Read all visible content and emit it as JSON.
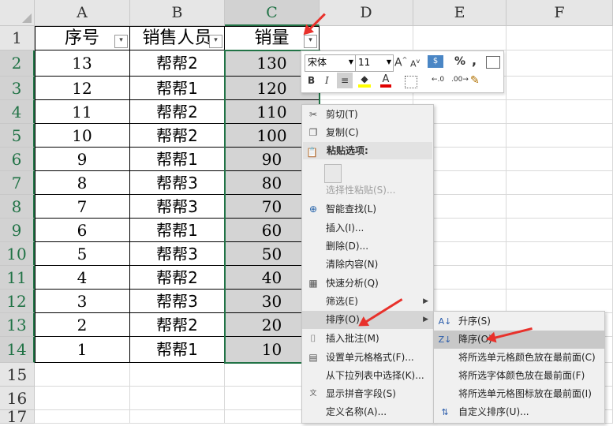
{
  "columns": [
    "A",
    "B",
    "C",
    "D",
    "E",
    "F"
  ],
  "rows": [
    "1",
    "2",
    "3",
    "4",
    "5",
    "6",
    "7",
    "8",
    "9",
    "10",
    "11",
    "12",
    "13",
    "14",
    "15",
    "16",
    "17"
  ],
  "headers": {
    "a": "序号",
    "b": "销售人员",
    "c": "销量"
  },
  "table": [
    {
      "a": "13",
      "b": "帮帮2",
      "c": "130"
    },
    {
      "a": "12",
      "b": "帮帮1",
      "c": "120"
    },
    {
      "a": "11",
      "b": "帮帮2",
      "c": "110"
    },
    {
      "a": "10",
      "b": "帮帮2",
      "c": "100"
    },
    {
      "a": "9",
      "b": "帮帮1",
      "c": "90"
    },
    {
      "a": "8",
      "b": "帮帮3",
      "c": "80"
    },
    {
      "a": "7",
      "b": "帮帮3",
      "c": "70"
    },
    {
      "a": "6",
      "b": "帮帮1",
      "c": "60"
    },
    {
      "a": "5",
      "b": "帮帮3",
      "c": "50"
    },
    {
      "a": "4",
      "b": "帮帮2",
      "c": "40"
    },
    {
      "a": "3",
      "b": "帮帮3",
      "c": "30"
    },
    {
      "a": "2",
      "b": "帮帮2",
      "c": "20"
    },
    {
      "a": "1",
      "b": "帮帮1",
      "c": "10"
    }
  ],
  "mini_toolbar": {
    "font": "宋体",
    "size": "11",
    "grow": "A",
    "shrink": "A",
    "percent": "%",
    "comma": ",",
    "bold": "B",
    "italic": "I",
    "font_color": "A",
    "inc_dec": "←.0",
    "dec_dec": ".00→"
  },
  "menu": {
    "cut": "剪切(T)",
    "copy": "复制(C)",
    "paste_options": "粘贴选项:",
    "paste_special": "选择性粘贴(S)...",
    "smart_lookup": "智能查找(L)",
    "insert": "插入(I)...",
    "delete": "删除(D)...",
    "clear": "清除内容(N)",
    "quick_analysis": "快速分析(Q)",
    "filter": "筛选(E)",
    "sort": "排序(O)",
    "insert_comment": "插入批注(M)",
    "format_cells": "设置单元格格式(F)...",
    "pick_list": "从下拉列表中选择(K)...",
    "phonetic": "显示拼音字段(S)",
    "define_name": "定义名称(A)..."
  },
  "submenu": {
    "asc": "升序(S)",
    "desc": "降序(O)",
    "cell_color": "将所选单元格颜色放在最前面(C)",
    "font_color": "将所选字体颜色放在最前面(F)",
    "icon": "将所选单元格图标放在最前面(I)",
    "custom": "自定义排序(U)..."
  },
  "colors": {
    "accent": "#217346",
    "arrow": "#e8312b"
  }
}
